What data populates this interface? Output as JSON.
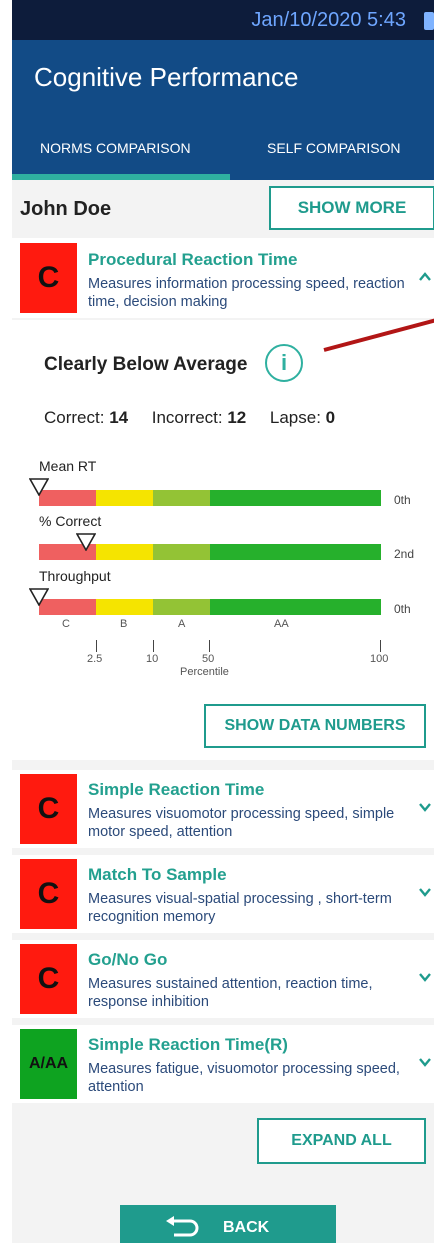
{
  "status": {
    "datetime": "Jan/10/2020 5:43"
  },
  "app": {
    "title": "Cognitive Performance"
  },
  "tabs": [
    {
      "label": "NORMS COMPARISON",
      "active": true
    },
    {
      "label": "SELF COMPARISON",
      "active": false
    }
  ],
  "user": {
    "name": "John Doe",
    "show_more": "SHOW MORE"
  },
  "expanded_test": {
    "grade": "C",
    "title": "Procedural Reaction Time",
    "description": "Measures information processing speed, reaction time, decision making",
    "level": "Clearly Below Average",
    "info_icon": "i",
    "correct_label": "Correct:",
    "correct": "14",
    "incorrect_label": "Incorrect:",
    "incorrect": "12",
    "lapse_label": "Lapse:",
    "lapse": "0",
    "metrics": [
      {
        "label": "Mean RT",
        "percentile_text": "0th",
        "percentile": 0
      },
      {
        "label": "% Correct",
        "percentile_text": "2nd",
        "percentile": 2
      },
      {
        "label": "Throughput",
        "percentile_text": "0th",
        "percentile": 0
      }
    ],
    "bands": [
      "C",
      "B",
      "A",
      "AA"
    ],
    "ticks": [
      "2.5",
      "10",
      "50",
      "100"
    ],
    "axis_title": "Percentile",
    "show_data": "SHOW DATA NUMBERS"
  },
  "tests": [
    {
      "grade": "C",
      "title": "Simple Reaction Time",
      "description": "Measures visuomotor processing speed, simple motor speed, attention"
    },
    {
      "grade": "C",
      "title": "Match To Sample",
      "description": "Measures visual-spatial processing , short-term recognition memory"
    },
    {
      "grade": "C",
      "title": "Go/No Go",
      "description": "Measures sustained attention, reaction time, response inhibition"
    },
    {
      "grade": "A/AA",
      "title": "Simple Reaction Time(R)",
      "description": "Measures fatigue, visuomotor processing speed, attention"
    }
  ],
  "actions": {
    "expand_all": "EXPAND ALL",
    "back": "BACK"
  },
  "colors": {
    "primary": "#124b86",
    "accent": "#1f9b8d",
    "grade_c": "#ff1a0f",
    "grade_aa": "#0ea320"
  }
}
